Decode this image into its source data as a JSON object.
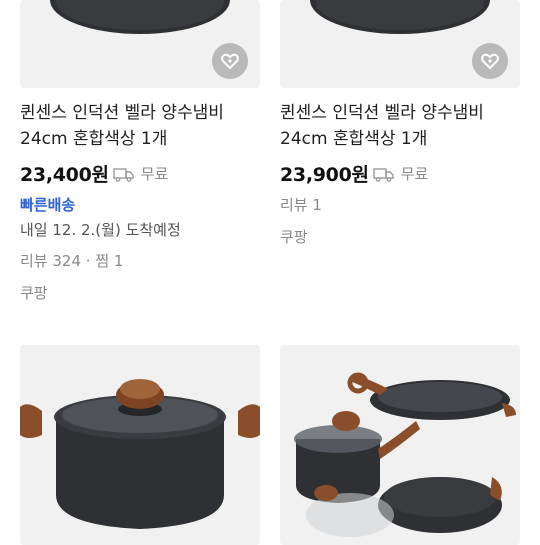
{
  "products": [
    {
      "title_line1": "퀸센스 인덕션 벨라 양수냄비",
      "title_line2": "24cm 혼합색상 1개",
      "price": "23,400원",
      "shipping": "무료",
      "fast_delivery": "빠른배송",
      "arrival": "내일 12. 2.(월) 도착예정",
      "reviews": "리뷰 324",
      "likes": "찜 1",
      "source": "쿠팡"
    },
    {
      "title_line1": "퀸센스 인덕션 벨라 양수냄비",
      "title_line2": "24cm 혼합색상 1개",
      "price": "23,900원",
      "shipping": "무료",
      "reviews": "리뷰 1",
      "source": "쿠팡"
    }
  ],
  "icons": {
    "favorite": "heart-tag-icon",
    "truck": "truck-icon"
  },
  "colors": {
    "fast_delivery": "#2f63d3",
    "pot_body": "#2f3033",
    "handle": "#8a4f2a"
  }
}
